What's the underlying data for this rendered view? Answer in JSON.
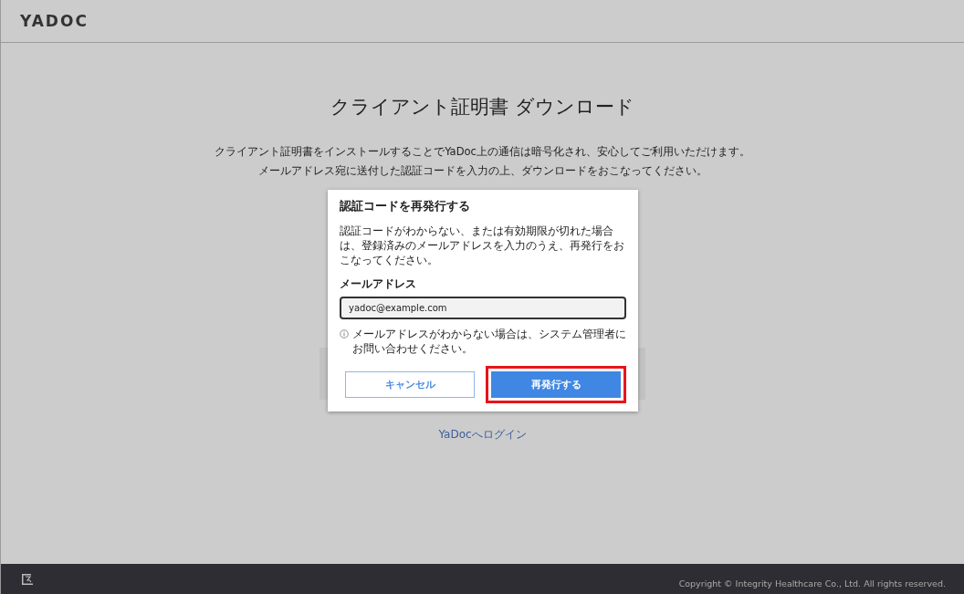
{
  "header": {
    "logo": "YADOC"
  },
  "page": {
    "title": "クライアント証明書 ダウンロード",
    "description": [
      "クライアント証明書をインストールすることでYaDoc上の通信は暗号化され、安心してご利用いただけます。",
      "メールアドレス宛に送付した認証コードを入力の上、ダウンロードをおこなってください。"
    ],
    "login_link": "YaDocへログイン"
  },
  "dialog": {
    "title": "認証コードを再発行する",
    "message": "認証コードがわからない、または有効期限が切れた場合は、登録済みのメールアドレスを入力のうえ、再発行をおこなってください。",
    "field": {
      "label": "メールアドレス",
      "value": "yadoc@example.com"
    },
    "note": "メールアドレスがわからない場合は、システム管理者にお問い合わせください。",
    "buttons": [
      {
        "label": "キャンセル",
        "kind": "secondary",
        "highlighted": false
      },
      {
        "label": "再発行する",
        "kind": "primary",
        "highlighted": true
      }
    ]
  },
  "footer": {
    "copyright": "Copyright © Integrity Healthcare Co., Ltd. All rights reserved."
  }
}
